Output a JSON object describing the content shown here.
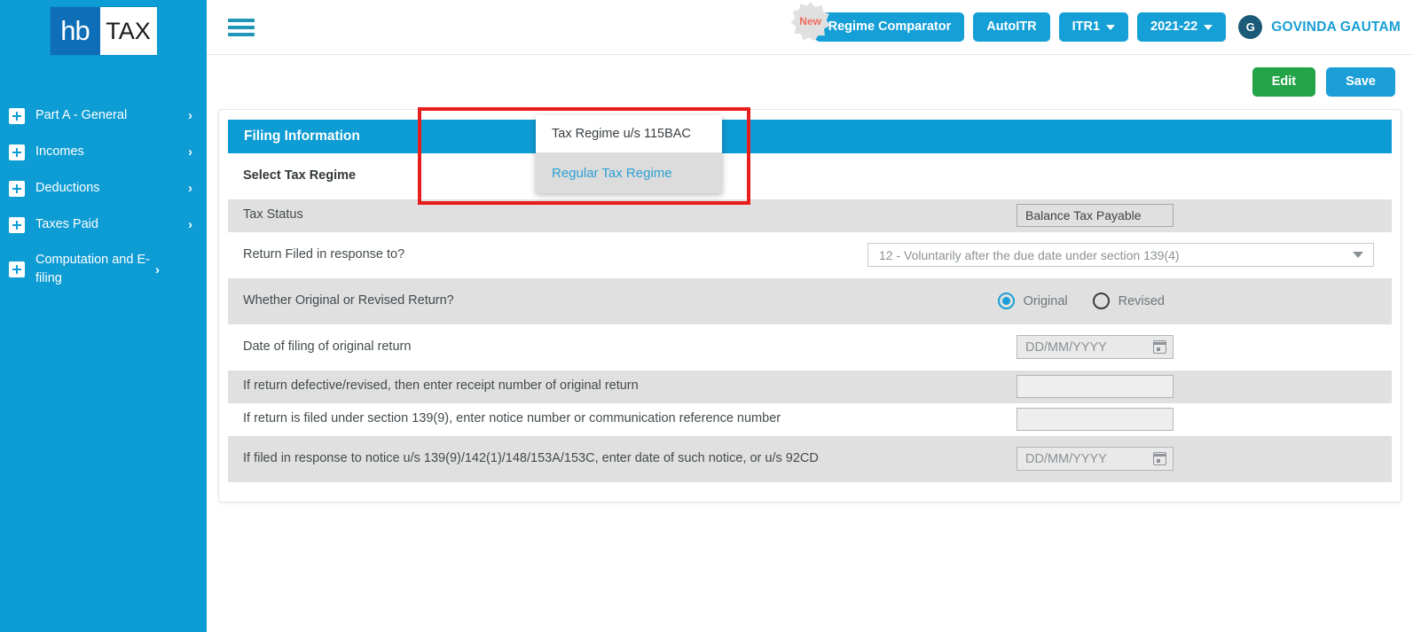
{
  "brand": {
    "logo_left": "hb",
    "logo_right": "TAX",
    "accent_blue": "#0d9cd4",
    "accent_green": "#22a447",
    "accent_red": "#e81d1d",
    "link_blue": "#2e9fd4"
  },
  "sidebar": {
    "items": [
      {
        "label": "Part A - General",
        "icon": "plus-icon",
        "chevron": "›"
      },
      {
        "label": "Incomes",
        "icon": "plus-icon",
        "chevron": "›"
      },
      {
        "label": "Deductions",
        "icon": "plus-icon",
        "chevron": "›"
      },
      {
        "label": "Taxes Paid",
        "icon": "plus-icon",
        "chevron": "›"
      },
      {
        "label": "Computation and E-filing",
        "icon": "plus-icon",
        "chevron": "›"
      }
    ]
  },
  "topbar": {
    "menu_icon": "hamburger-icon",
    "new_badge": "New",
    "regime_comparator": "Regime Comparator",
    "autoitr": "AutoITR",
    "form_type": "ITR1",
    "assessment_year": "2021-22",
    "avatar_initial": "G",
    "username": "GOVINDA GAUTAM"
  },
  "actions": {
    "edit": "Edit",
    "save": "Save"
  },
  "card": {
    "header_title": "Filing Information",
    "rows": [
      {
        "label": "Select Tax Regime",
        "control": "dropdown-open",
        "bold": true
      },
      {
        "label": "Tax Status",
        "control": "text-box",
        "value": "Balance Tax Payable"
      },
      {
        "label": "Return Filed in response to?",
        "control": "select",
        "value": "12 - Voluntarily after the due date under section 139(4)"
      },
      {
        "label": "Whether Original or Revised Return?",
        "control": "radio",
        "options": [
          "Original",
          "Revised"
        ],
        "selected": "Original"
      },
      {
        "label": "Date of filing of original return",
        "control": "date",
        "placeholder": "DD/MM/YYYY",
        "value": ""
      },
      {
        "label": "If return defective/revised, then enter receipt number of original return",
        "control": "input",
        "placeholder": "",
        "value": ""
      },
      {
        "label": "If return is filed under section 139(9), enter notice number or communication reference number",
        "control": "input",
        "placeholder": "",
        "value": ""
      },
      {
        "label": "If filed in response to notice u/s 139(9)/142(1)/148/153A/153C, enter date of such notice, or u/s 92CD",
        "control": "date",
        "placeholder": "DD/MM/YYYY",
        "value": ""
      }
    ]
  },
  "regime_dropdown": {
    "options": [
      {
        "label": "Tax Regime u/s 115BAC",
        "selected": false
      },
      {
        "label": "Regular Tax Regime",
        "selected": true
      }
    ]
  }
}
